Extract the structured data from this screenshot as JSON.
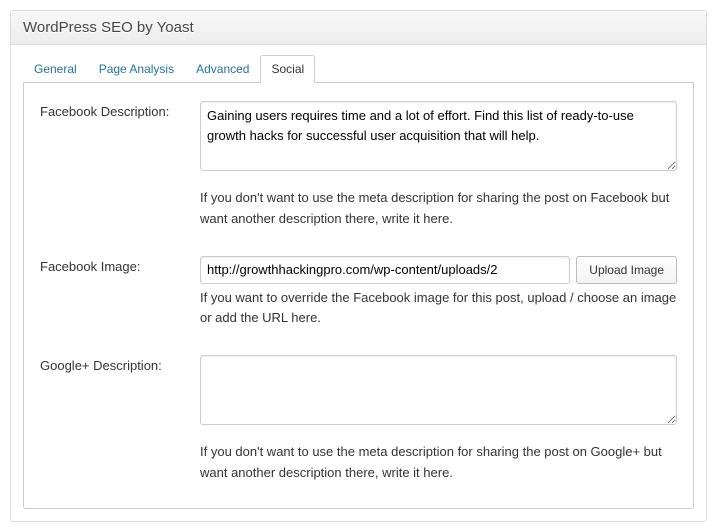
{
  "header": {
    "title": "WordPress SEO by Yoast"
  },
  "tabs": {
    "general": "General",
    "page_analysis": "Page Analysis",
    "advanced": "Advanced",
    "social": "Social"
  },
  "fields": {
    "fb_desc": {
      "label": "Facebook Description:",
      "value": "Gaining users requires time and a lot of effort. Find this list of ready-to-use growth hacks for successful user acquisition that will help.",
      "help": "If you don't want to use the meta description for sharing the post on Facebook but want another description there, write it here."
    },
    "fb_image": {
      "label": "Facebook Image:",
      "url": "http://growthhackingpro.com/wp-content/uploads/2",
      "button": "Upload Image",
      "help": "If you want to override the Facebook image for this post, upload / choose an image or add the URL here."
    },
    "gp_desc": {
      "label": "Google+ Description:",
      "value": "",
      "help": "If you don't want to use the meta description for sharing the post on Google+ but want another description there, write it here."
    }
  }
}
